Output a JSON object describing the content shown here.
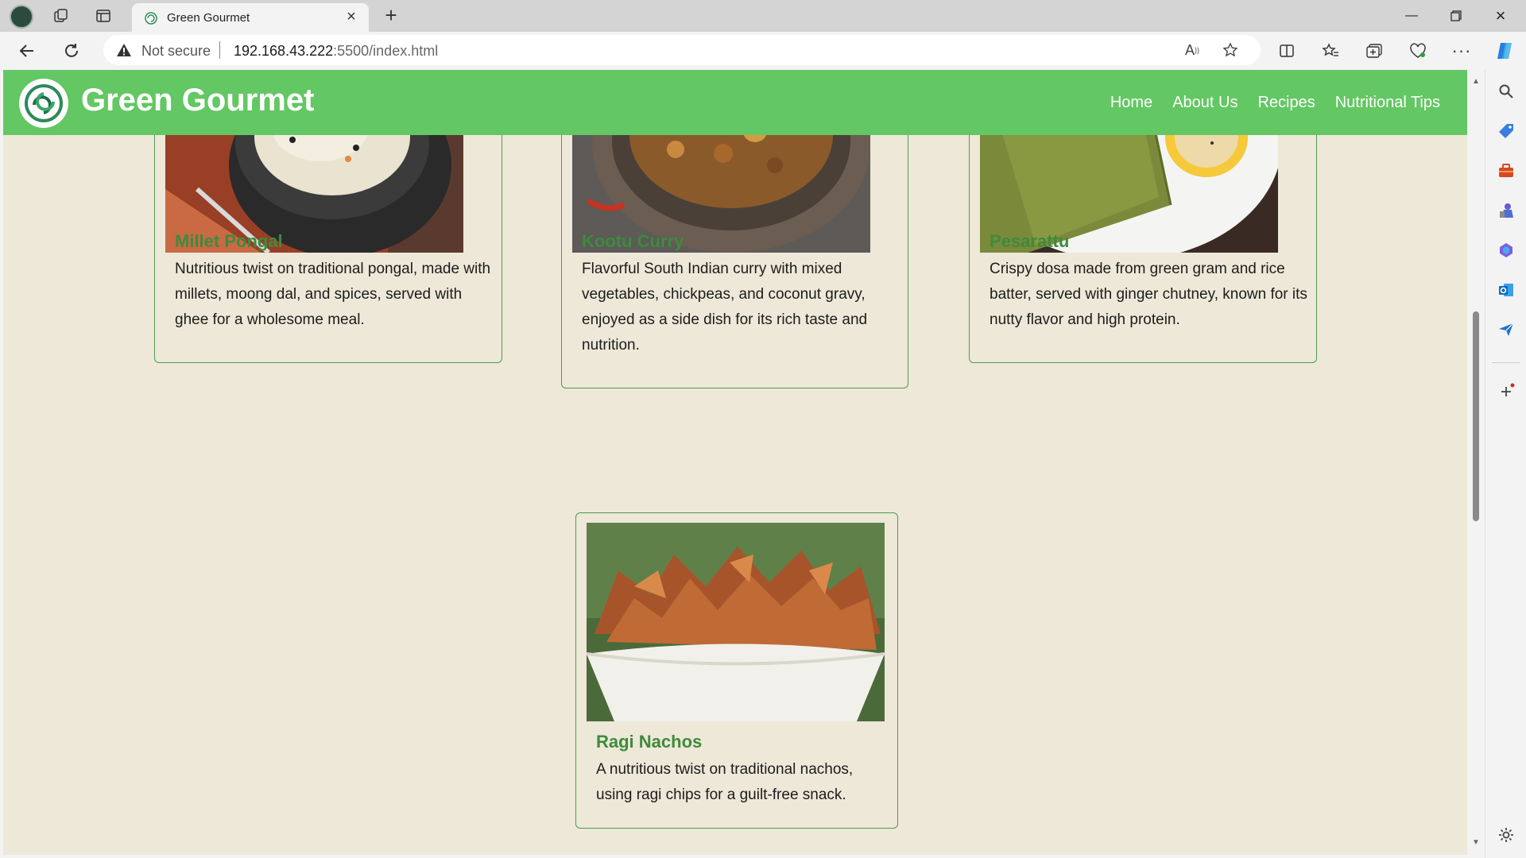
{
  "browser": {
    "tab_title": "Green Gourmet",
    "security_label": "Not secure",
    "url_host": "192.168.43.222",
    "url_rest": ":5500/index.html"
  },
  "site": {
    "brand": "Green Gourmet",
    "nav": [
      "Home",
      "About Us",
      "Recipes",
      "Nutritional Tips"
    ],
    "colors": {
      "header": "#63c763",
      "heading": "#3d8b3d",
      "background": "#ede8d8"
    }
  },
  "recipes": [
    {
      "name": "Millet Pongal",
      "description": "Nutritious twist on traditional pongal, made with millets, moong dal, and spices, served with ghee for a wholesome meal."
    },
    {
      "name": "Kootu Curry",
      "description": "Flavorful South Indian curry with mixed vegetables, chickpeas, and coconut gravy, enjoyed as a side dish for its rich taste and nutrition."
    },
    {
      "name": "Pesarattu",
      "description": "Crispy dosa made from green gram and rice batter, served with ginger chutney, known for its nutty flavor and high protein."
    },
    {
      "name": "Ragi Nachos",
      "description": "A nutritious twist on traditional nachos, using ragi chips for a guilt-free snack."
    }
  ]
}
